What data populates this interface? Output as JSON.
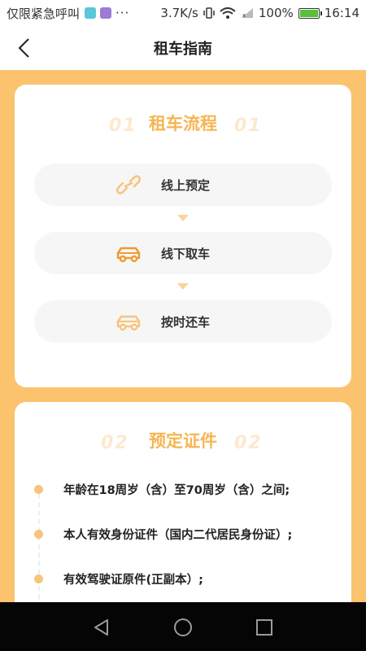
{
  "status_bar": {
    "carrier": "仅限紧急呼叫",
    "notif_icons": [
      "android-app-icon",
      "gallery-icon"
    ],
    "more": "···",
    "speed": "3.7K/s",
    "battery": "100%",
    "time": "16:14"
  },
  "header": {
    "title": "租车指南"
  },
  "process": {
    "num": "01",
    "title": "租车流程",
    "steps": [
      {
        "label": "线上预定",
        "icon": "link-icon"
      },
      {
        "label": "线下取车",
        "icon": "car-icon"
      },
      {
        "label": "按时还车",
        "icon": "car-return-icon"
      }
    ]
  },
  "documents": {
    "num": "02",
    "title": "预定证件",
    "items": [
      "年龄在18周岁（含）至70周岁（含）之间;",
      "本人有效身份证件（国内二代居民身份证）;",
      "有效驾驶证原件(正副本）;"
    ]
  },
  "colors": {
    "accent": "#f6b552",
    "background": "#fbc36e",
    "icon_orange": "#ef9a34"
  },
  "nav": {
    "buttons": [
      "back-nav-icon",
      "home-nav-icon",
      "recents-nav-icon"
    ]
  }
}
